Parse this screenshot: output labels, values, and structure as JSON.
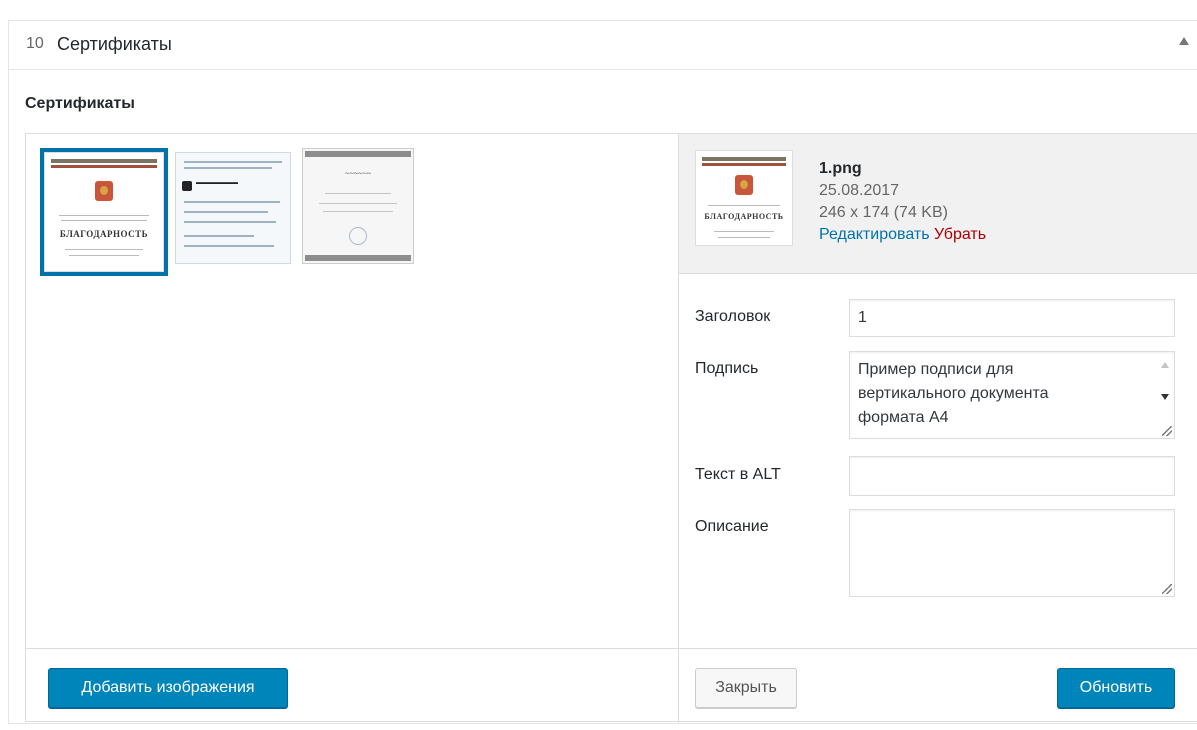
{
  "header": {
    "count": "10",
    "title": "Сертификаты"
  },
  "section": {
    "label": "Сертификаты"
  },
  "thumbnails": [
    {
      "icon": "blagodarnost-document-thumbnail",
      "selected": true
    },
    {
      "icon": "certificate-of-conformity-thumbnail",
      "selected": false
    },
    {
      "icon": "certificate-diploma-thumbnail",
      "selected": false
    }
  ],
  "selected": {
    "filename": "1.png",
    "date": "25.08.2017",
    "dimensions": "246 x 174 (74 KB)",
    "edit_label": "Редактировать",
    "remove_label": "Убрать",
    "preview_word": "БЛАГОДАРНОСТЬ"
  },
  "fields": {
    "title_label": "Заголовок",
    "title_value": "1",
    "caption_label": "Подпись",
    "caption_lines": [
      "Пример подписи для",
      "вертикального документа",
      "формата А4"
    ],
    "alt_label": "Текст в ALT",
    "alt_value": "",
    "description_label": "Описание",
    "description_value": ""
  },
  "buttons": {
    "add_images": "Добавить изображения",
    "close": "Закрыть",
    "update": "Обновить"
  },
  "colors": {
    "primary": "#0085ba",
    "selection": "#0073aa",
    "link": "#0073aa",
    "danger": "#a00"
  }
}
